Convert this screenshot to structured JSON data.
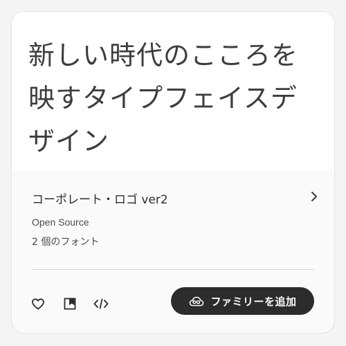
{
  "preview": {
    "sample_text": "新しい時代のこころを映すタイプフェイスデザイン"
  },
  "family": {
    "name": "コーポレート・ロゴ ver2",
    "foundry": "Open Source",
    "font_count": "2 個のフォント"
  },
  "actions": {
    "add_family_label": "ファミリーを追加"
  },
  "icons": {
    "favorite": "heart-icon",
    "collection": "bookmark-icon",
    "web_project": "code-icon",
    "creative_cloud": "creative-cloud-icon",
    "open_details": "chevron-right-icon"
  },
  "colors": {
    "button_bg": "#2c2c2c",
    "text_primary": "#3d3d3d"
  }
}
